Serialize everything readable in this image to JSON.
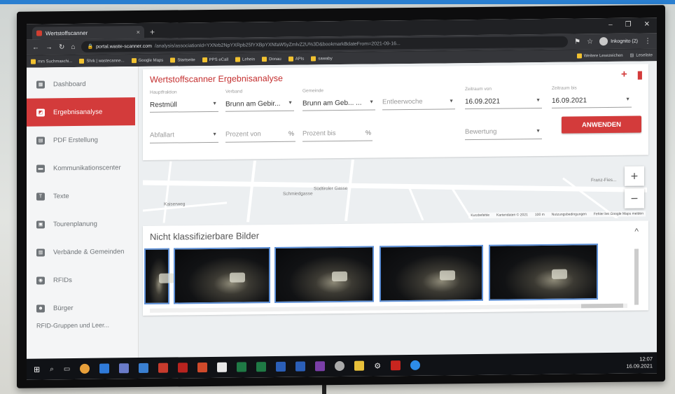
{
  "browser": {
    "tab_title": "Wertstoffscanner",
    "tab_close": "×",
    "new_tab": "+",
    "window_controls": [
      "–",
      "❐",
      "✕"
    ],
    "url_host": "portal.waste-scanner.com",
    "url_path": "/analysis/associationId=YXNrb2NpYXRpb25fYXBpYXNfaW5yZmlvZ2U%3D&bookmarkBdateFrom=2021-09-16...",
    "incognito_label": "Inkognito (2)",
    "bookmarks": [
      "mm Suchmaschi...",
      "Shrk | wastecanne...",
      "Google Maps",
      "Startseite",
      "PPS eCall",
      "Lehein",
      "Donau",
      "APIs",
      "sawaby"
    ],
    "bookmarks_right": [
      "Weitere Lesezeichen",
      "Leseliste"
    ]
  },
  "sidebar": {
    "items": [
      {
        "label": "Dashboard",
        "icon": "dashboard-icon",
        "glyph": "▦"
      },
      {
        "label": "Ergebnisanalyse",
        "icon": "analysis-icon",
        "glyph": "◩",
        "active": true
      },
      {
        "label": "PDF Erstellung",
        "icon": "pdf-icon",
        "glyph": "▤"
      },
      {
        "label": "Kommunikationscenter",
        "icon": "chat-icon",
        "glyph": "▬"
      },
      {
        "label": "Texte",
        "icon": "text-icon",
        "glyph": "T"
      },
      {
        "label": "Tourenplanung",
        "icon": "calendar-icon",
        "glyph": "▣"
      },
      {
        "label": "Verbände & Gemeinden",
        "icon": "building-icon",
        "glyph": "▥"
      },
      {
        "label": "RFIDs",
        "icon": "rfid-icon",
        "glyph": "◉"
      },
      {
        "label": "Bürger",
        "icon": "people-icon",
        "glyph": "☻"
      }
    ],
    "more": "RFID-Gruppen und Leer..."
  },
  "filters": {
    "page_title": "Wertstoffscanner Ergebnisanalyse",
    "add_icon": "+",
    "bookmark_icon": "▮",
    "fraction_label": "Hauptfraktion",
    "fraction_value": "Restmüll",
    "verband_label": "Verband",
    "verband_value": "Brunn am Gebir...",
    "gemeinde_label": "Gemeinde",
    "gemeinde_value": "Brunn am Geb... ...",
    "leerwoche_placeholder": "Entleerwoche",
    "from_label": "Zeitraum von",
    "from_value": "16.09.2021",
    "to_label": "Zeitraum bis",
    "to_value": "16.09.2021",
    "abfallart_placeholder": "Abfallart",
    "prozent_von": "Prozent von",
    "prozent_bis": "Prozent bis",
    "percent_sign": "%",
    "bewertung_placeholder": "Bewertung",
    "apply_label": "ANWENDEN"
  },
  "map": {
    "streets": [
      "Südtiroler Gasse",
      "Franz-Fies...",
      "Schmiedgasse",
      "Kaiserweg"
    ],
    "zoom_in": "+",
    "zoom_out": "−",
    "attribution": [
      "Kurzbefehle",
      "Kartendaten © 2021",
      "100 m",
      "Nutzungsbedingungen",
      "Fehler bei Google Maps melden"
    ]
  },
  "images": {
    "title": "Nicht klassifizierbare Bilder",
    "collapse": "^",
    "count": 5
  },
  "taskbar": {
    "time": "12:07",
    "date": "16.09.2021"
  }
}
